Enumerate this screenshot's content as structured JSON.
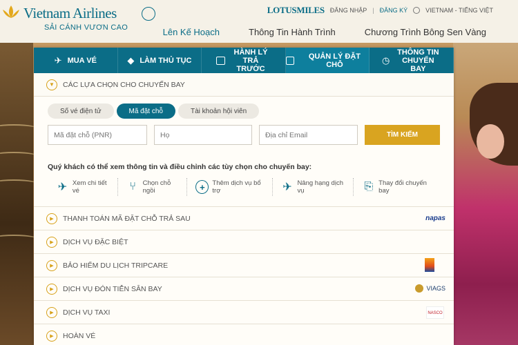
{
  "header": {
    "logo_text": "Vietnam Airlines",
    "logo_tagline": "SẢI CÁNH VƯƠN CAO",
    "lotusmiles": "LOTUSMILES",
    "login": "ĐĂNG NHẬP",
    "register": "ĐĂNG KÝ",
    "language": "VIETNAM - TIẾNG VIỆT",
    "nav": [
      "Lên Kế Hoạch",
      "Thông Tin Hành Trình",
      "Chương Trình Bông Sen Vàng"
    ]
  },
  "tabs": [
    {
      "label": "MUA VÉ",
      "icon": "airplane-icon"
    },
    {
      "label": "LÀM THỦ TỤC",
      "icon": "ticket-icon"
    },
    {
      "label": "HÀNH LÝ TRẢ TRƯỚC",
      "icon": "luggage-icon"
    },
    {
      "label": "QUẢN LÝ ĐẶT CHỖ",
      "icon": "booking-icon",
      "active": true
    },
    {
      "label": "THÔNG TIN CHUYẾN BAY",
      "icon": "clock-icon"
    }
  ],
  "options_section": {
    "title": "CÁC LỰA CHỌN CHO CHUYẾN BAY",
    "segments": [
      "Số vé điện tử",
      "Mã đặt chỗ",
      "Tài khoản hội viên"
    ],
    "active_segment": "Mã đặt chỗ",
    "fields": {
      "pnr_placeholder": "Mã đặt chỗ (PNR)",
      "surname_placeholder": "Họ",
      "email_placeholder": "Địa chỉ Email"
    },
    "search_label": "TÌM KIẾM",
    "info_text": "Quý khách có thể xem thông tin và điều chỉnh các tùy chọn cho chuyến bay:",
    "actions": [
      {
        "label": "Xem chi tiết vé",
        "icon": "plane-detail-icon"
      },
      {
        "label": "Chọn chỗ ngồi",
        "icon": "seat-icon"
      },
      {
        "label": "Thêm dịch vụ bổ trợ",
        "icon": "plus-icon"
      },
      {
        "label": "Nâng hạng dịch vụ",
        "icon": "upgrade-icon"
      },
      {
        "label": "Thay đổi chuyến bay",
        "icon": "change-ticket-icon"
      }
    ]
  },
  "rows": [
    {
      "label": "THANH TOÁN MÃ ĐẶT CHỖ TRẢ SAU",
      "logo": "napas"
    },
    {
      "label": "DỊCH VỤ ĐẶC BIỆT",
      "logo": ""
    },
    {
      "label": "BẢO HIỂM DU LỊCH TRIPCARE",
      "logo": "pvi"
    },
    {
      "label": "DỊCH VỤ ĐÓN TIỄN SÂN BAY",
      "logo": "VIAGS"
    },
    {
      "label": "DỊCH VỤ TAXI",
      "logo": "NASCO"
    },
    {
      "label": "HOÀN VÉ",
      "logo": ""
    }
  ],
  "logos": {
    "napas": "napas",
    "viags": "VIAGS",
    "nasco": "NASCO"
  },
  "colors": {
    "primary": "#0b6d87",
    "accent": "#d9a420"
  }
}
